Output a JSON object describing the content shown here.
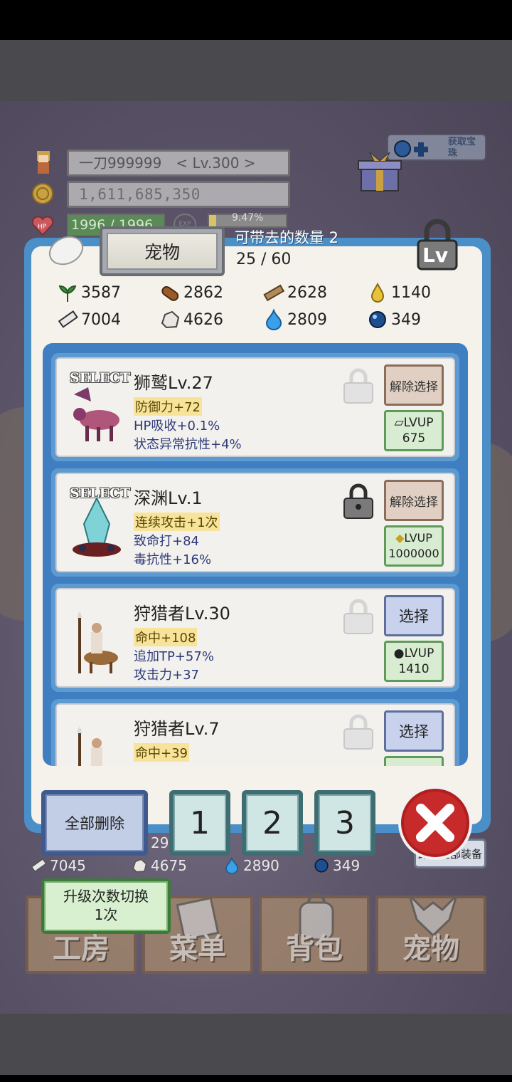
{
  "player": {
    "name_level": "一刀999999　< Lv.300 >",
    "gold": "1,611,685,350",
    "hp": "1996 / 1996",
    "exp_label": "EXP",
    "exp_percent": "9.47%",
    "hp_icon_label": "HP"
  },
  "corner_button": {
    "label": "获取宝珠"
  },
  "modal": {
    "tab_label": "宠物",
    "carry_label": "可带去的数量 2",
    "count": "25 / 60",
    "lv_icon_label": "Lv"
  },
  "resources": [
    {
      "icon": "herb-icon",
      "value": "3587"
    },
    {
      "icon": "wood-log-icon",
      "value": "2862"
    },
    {
      "icon": "plank-icon",
      "value": "2628"
    },
    {
      "icon": "oil-drop-icon",
      "value": "1140"
    },
    {
      "icon": "whetstone-icon",
      "value": "7004"
    },
    {
      "icon": "ore-icon",
      "value": "4626"
    },
    {
      "icon": "blue-flame-icon",
      "value": "2809"
    },
    {
      "icon": "orb-icon",
      "value": "349"
    }
  ],
  "pets": [
    {
      "selected": true,
      "select_tag": "SELECT",
      "name": "狮鹫Lv.27",
      "stats": [
        "防御力+72",
        "HP吸收+0.1%",
        "状态异常抗性+4%"
      ],
      "action": "解除选择",
      "lvup": "LVUP",
      "lvup_cost": "675",
      "locked": false
    },
    {
      "selected": true,
      "select_tag": "SELECT",
      "name": "深渊Lv.1",
      "stats": [
        "连续攻击+1次",
        "致命打+84",
        "毒抗性+16%"
      ],
      "action": "解除选择",
      "lvup": "LVUP",
      "lvup_cost": "1000000",
      "locked": true
    },
    {
      "selected": false,
      "name": "狩猎者Lv.30",
      "stats": [
        "命中+108",
        "追加TP+57%",
        "攻击力+37"
      ],
      "action": "选择",
      "lvup": "LVUP",
      "lvup_cost": "1410",
      "locked": false
    },
    {
      "selected": false,
      "name": "狩猎者Lv.7",
      "stats": [
        "命中+39"
      ],
      "action": "选择",
      "locked": false
    }
  ],
  "buttons": {
    "delete_all": "全部删除",
    "slot1": "1",
    "slot2": "2",
    "slot3": "3"
  },
  "behind": {
    "res": [
      {
        "icon": "whetstone-icon",
        "value": "7045"
      },
      {
        "icon": "ore-icon",
        "value": "4675"
      },
      {
        "icon": "blue-flame-icon",
        "value": "2890"
      },
      {
        "icon": "orb-icon",
        "value": "349"
      }
    ],
    "partial_value": "29",
    "unequip_all": "卸下全部装备",
    "upgrade_toggle_line1": "升级次数切换",
    "upgrade_toggle_line2": "1次",
    "nav": [
      "工房",
      "菜单",
      "背包",
      "宠物"
    ]
  }
}
